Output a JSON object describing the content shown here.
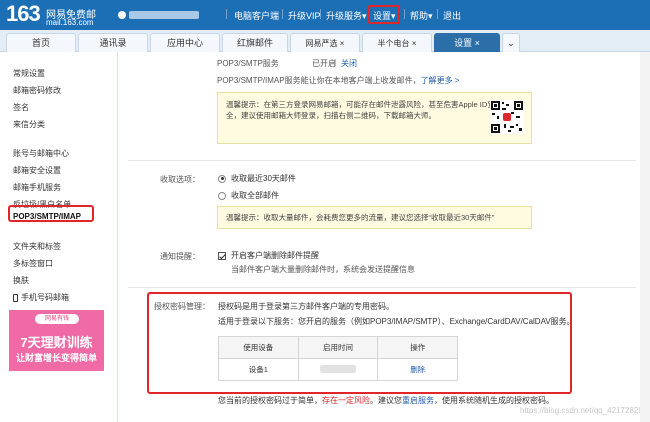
{
  "logo": {
    "number": "163",
    "title": "网易免费邮",
    "domain": "mail.163.com"
  },
  "header": {
    "links": [
      "电脑客户端",
      "升级VIP",
      "升级服务",
      "设置",
      "帮助",
      "退出"
    ],
    "arrow": "▾"
  },
  "tabs": [
    "首页",
    "通讯录",
    "应用中心",
    "红旗邮件",
    "网易严选",
    "半个电台",
    "设置"
  ],
  "tab_close": "×",
  "tab_more": "⌄",
  "sidebar": {
    "items": [
      "常规设置",
      "邮箱密码修改",
      "签名",
      "来信分类",
      "账号与邮箱中心",
      "邮箱安全设置",
      "邮箱手机服务",
      "反垃圾/黑白名单",
      "POP3/SMTP/IMAP",
      "文件夹和标签",
      "多标签窗口",
      "换肤",
      "手机号码邮箱"
    ],
    "ad": {
      "tag": "网易有钱",
      "line1": "7天理财训练",
      "line2": "让财富增长变得简单"
    }
  },
  "main": {
    "pop3": {
      "label": "POP3/SMTP服务",
      "status": "已开启",
      "divider": "|",
      "action": "关闭"
    },
    "desc": "POP3/SMTP/IMAP服务能让你在本地客户端上收发邮件，",
    "more": "了解更多 >",
    "tip1": {
      "line1": "温馨提示：在第三方登录网易邮箱，可能存在邮件泄露风险，甚至危害Apple ID安",
      "line2": "全，建议使用邮箱大师登录，扫描右侧二维码，下载邮箱大师。"
    },
    "receive": {
      "label": "收取选项：",
      "opt1": "收取最近30天邮件",
      "opt2": "收取全部邮件"
    },
    "tip2": "温馨提示：收取大量邮件，会耗费您更多的流量，建议您选择“收取最近30天邮件”",
    "notify": {
      "label": "通知提醒：",
      "check": "开启客户端删除邮件提醒",
      "sub": "当邮件客户端大量删除邮件时，系统会发送提醒信息"
    },
    "auth": {
      "label": "授权密码管理：",
      "desc1": "授权码是用于登录第三方邮件客户端的专用密码。",
      "desc2": "适用于登录以下服务：您开启的服务（例如POP3/IMAP/SMTP）、Exchange/CardDAV/CalDAV服务。",
      "headers": [
        "使用设备",
        "启用时间",
        "操作"
      ],
      "row": {
        "device": "设备1",
        "action": "删除"
      }
    },
    "footer": {
      "a": "您当前的授权密码过于简单，",
      "b": "存在一定风险",
      "c": "。建议您",
      "d": "重启服务",
      "e": "，使用系统随机生成的授权密码。"
    }
  },
  "watermark": "https://blog.csdn.net/qq_42172829"
}
